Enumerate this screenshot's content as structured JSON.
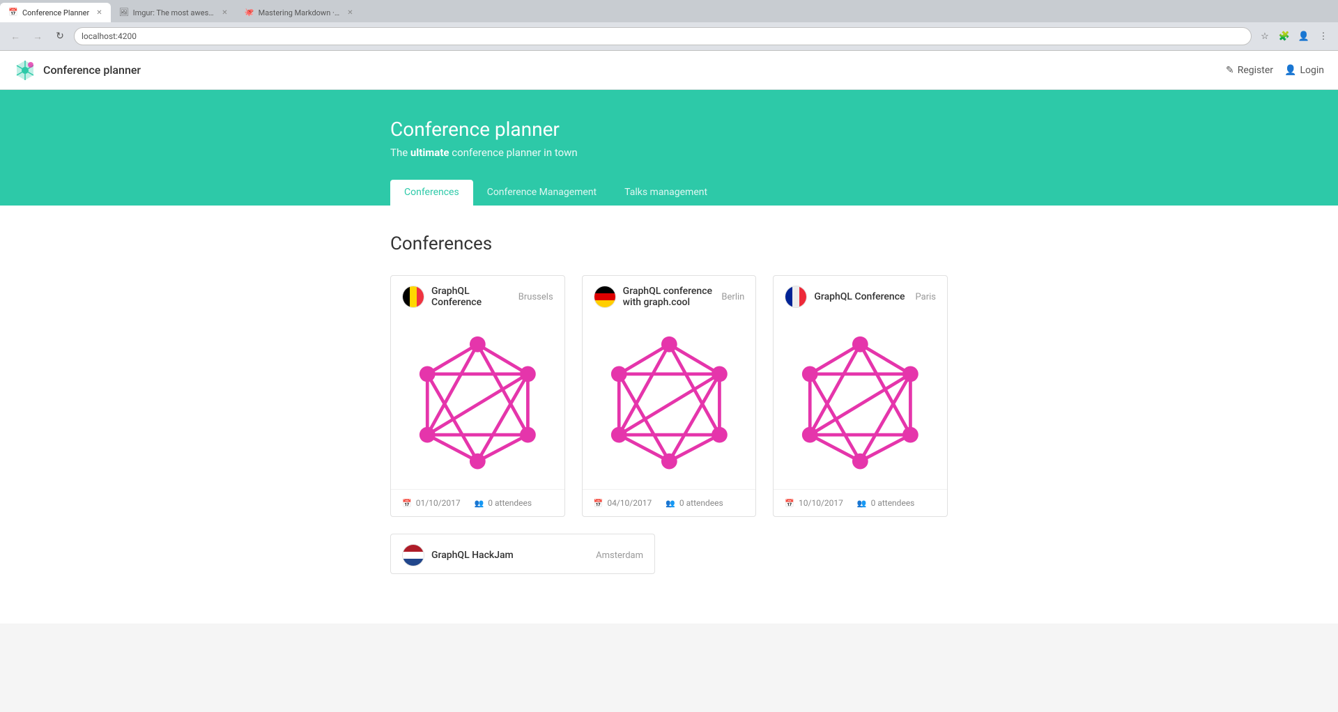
{
  "browser": {
    "tabs": [
      {
        "id": "tab1",
        "title": "Conference Planner",
        "active": true,
        "favicon": "📅"
      },
      {
        "id": "tab2",
        "title": "Imgur: The most awesome i...",
        "active": false,
        "favicon": "🖼"
      },
      {
        "id": "tab3",
        "title": "Mastering Markdown · GitH...",
        "active": false,
        "favicon": "🐙"
      }
    ],
    "address": "localhost:4200"
  },
  "navbar": {
    "logo_text": "Conference planner",
    "register_label": "Register",
    "login_label": "Login"
  },
  "hero": {
    "title": "Conference planner",
    "subtitle_prefix": "The ",
    "subtitle_bold": "ultimate",
    "subtitle_suffix": " conference planner in town",
    "tabs": [
      {
        "id": "conferences",
        "label": "Conferences",
        "active": true
      },
      {
        "id": "conference-management",
        "label": "Conference Management",
        "active": false
      },
      {
        "id": "talks-management",
        "label": "Talks management",
        "active": false
      }
    ]
  },
  "main": {
    "section_title": "Conferences",
    "conferences": [
      {
        "id": "c1",
        "name": "GraphQL Conference",
        "city": "Brussels",
        "date": "01/10/2017",
        "attendees": "0 attendees",
        "flag": "be"
      },
      {
        "id": "c2",
        "name": "GraphQL conference with graph.cool",
        "city": "Berlin",
        "date": "04/10/2017",
        "attendees": "0 attendees",
        "flag": "de"
      },
      {
        "id": "c3",
        "name": "GraphQL Conference",
        "city": "Paris",
        "date": "10/10/2017",
        "attendees": "0 attendees",
        "flag": "fr"
      }
    ],
    "partial_conferences": [
      {
        "id": "c4",
        "name": "GraphQL HackJam",
        "city": "Amsterdam",
        "flag": "nl"
      }
    ]
  },
  "colors": {
    "teal": "#2dc9a8",
    "graphql_pink": "#e535ab"
  }
}
